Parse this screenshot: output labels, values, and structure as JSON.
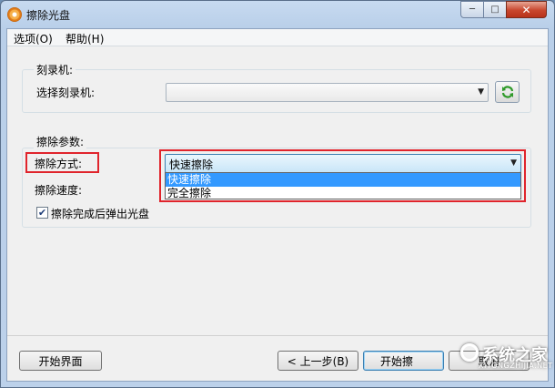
{
  "window": {
    "title": "擦除光盘"
  },
  "menu": {
    "items": [
      "选项(O)",
      "帮助(H)"
    ]
  },
  "recorder_group": {
    "title": "刻录机:",
    "select_label": "选择刻录机:",
    "select_value": ""
  },
  "erase_group": {
    "title": "擦除参数:",
    "method_label": "擦除方式:",
    "method_value": "快速擦除",
    "method_options": [
      "快速擦除",
      "完全擦除"
    ],
    "speed_label": "擦除速度:",
    "eject_label": "擦除完成后弹出光盘",
    "eject_checked": true
  },
  "footer": {
    "start_screen": "开始界面",
    "prev_step": "< 上一步(B)",
    "start": "开始擦",
    "cancel": "取消"
  },
  "watermark": {
    "text": "系统之家",
    "sub": "XITONGZHIJIA.NET"
  },
  "colors": {
    "highlight_box": "#e0242c",
    "selection": "#3399ff"
  }
}
